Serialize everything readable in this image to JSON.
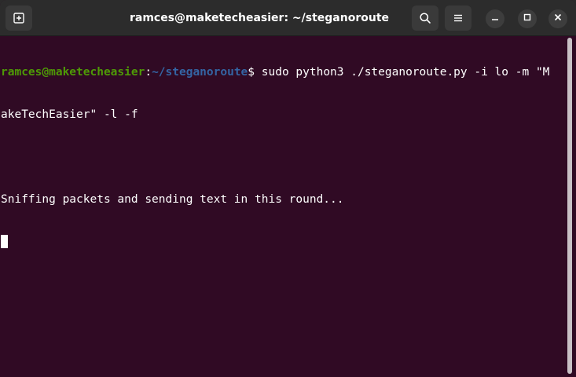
{
  "window": {
    "title": "ramces@maketecheasier: ~/steganoroute"
  },
  "titlebar": {
    "icons": {
      "new_tab": "new-tab-icon",
      "search": "search-icon",
      "menu": "hamburger-menu-icon",
      "minimize": "minimize-icon",
      "maximize": "maximize-icon",
      "close": "close-icon"
    }
  },
  "terminal": {
    "prompt_user": "ramces@maketecheasier",
    "prompt_colon": ":",
    "prompt_path": "~/steganoroute",
    "prompt_symbol": "$ ",
    "command_line1": "sudo python3 ./steganoroute.py -i lo -m \"M",
    "command_line2": "akeTechEasier\" -l -f",
    "output_line": "Sniffing packets and sending text in this round..."
  },
  "colors": {
    "background": "#300a24",
    "titlebar": "#2c2c2c",
    "prompt_user": "#4e9a06",
    "prompt_path": "#3465a4",
    "text": "#ffffff"
  }
}
